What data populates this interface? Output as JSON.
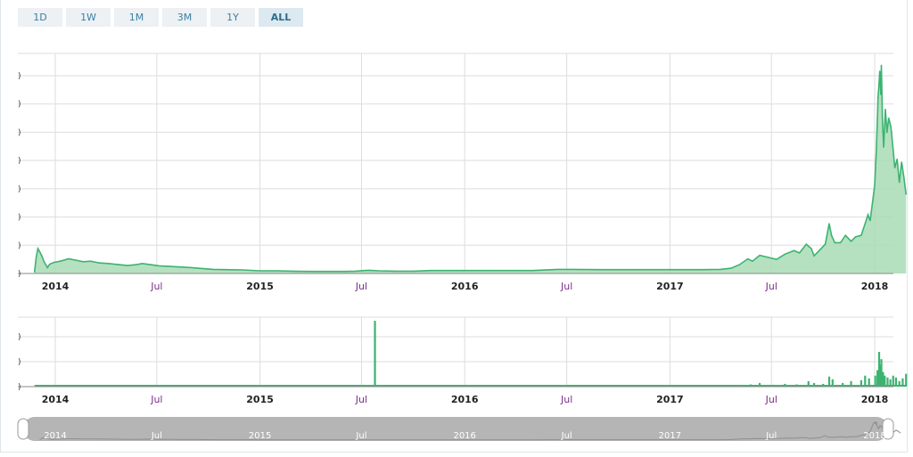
{
  "range_buttons": [
    {
      "label": "1D",
      "active": false
    },
    {
      "label": "1W",
      "active": false
    },
    {
      "label": "1M",
      "active": false
    },
    {
      "label": "3M",
      "active": false
    },
    {
      "label": "1Y",
      "active": false
    },
    {
      "label": "ALL",
      "active": true
    }
  ],
  "colors": {
    "line": "#3cb371",
    "fill": "#a8dcb5",
    "grid": "#dddddd",
    "navigator": "#b5b5b5"
  },
  "chart_data": [
    {
      "type": "area",
      "xaxis_ticks": [
        {
          "date": "2014-01-01",
          "label": "2014",
          "year": true
        },
        {
          "date": "2014-07-01",
          "label": "Jul",
          "year": false
        },
        {
          "date": "2015-01-01",
          "label": "2015",
          "year": true
        },
        {
          "date": "2015-07-01",
          "label": "Jul",
          "year": false
        },
        {
          "date": "2016-01-01",
          "label": "2016",
          "year": true
        },
        {
          "date": "2016-07-01",
          "label": "Jul",
          "year": false
        },
        {
          "date": "2017-01-01",
          "label": "2017",
          "year": true
        },
        {
          "date": "2017-07-01",
          "label": "Jul",
          "year": false
        },
        {
          "date": "2018-01-01",
          "label": "2018",
          "year": true
        }
      ],
      "ytick_labels": [
        ")",
        ")",
        ")",
        ")",
        ")",
        ")",
        ")",
        ")"
      ],
      "ylim": [
        0,
        7.5
      ],
      "grid": true,
      "points": [
        [
          "2013-11-25",
          0.05
        ],
        [
          "2013-11-28",
          0.55
        ],
        [
          "2013-12-01",
          0.85
        ],
        [
          "2013-12-04",
          0.75
        ],
        [
          "2013-12-08",
          0.6
        ],
        [
          "2013-12-12",
          0.4
        ],
        [
          "2013-12-18",
          0.2
        ],
        [
          "2013-12-22",
          0.32
        ],
        [
          "2013-12-30",
          0.38
        ],
        [
          "2014-01-10",
          0.42
        ],
        [
          "2014-01-25",
          0.5
        ],
        [
          "2014-02-05",
          0.46
        ],
        [
          "2014-02-20",
          0.4
        ],
        [
          "2014-03-05",
          0.42
        ],
        [
          "2014-03-20",
          0.36
        ],
        [
          "2014-04-10",
          0.33
        ],
        [
          "2014-04-25",
          0.3
        ],
        [
          "2014-05-10",
          0.27
        ],
        [
          "2014-05-25",
          0.3
        ],
        [
          "2014-06-05",
          0.34
        ],
        [
          "2014-06-20",
          0.3
        ],
        [
          "2014-07-05",
          0.26
        ],
        [
          "2014-07-25",
          0.24
        ],
        [
          "2014-08-15",
          0.22
        ],
        [
          "2014-09-01",
          0.2
        ],
        [
          "2014-09-20",
          0.17
        ],
        [
          "2014-10-10",
          0.14
        ],
        [
          "2014-11-01",
          0.13
        ],
        [
          "2014-12-01",
          0.12
        ],
        [
          "2015-01-01",
          0.09
        ],
        [
          "2015-02-01",
          0.09
        ],
        [
          "2015-03-01",
          0.08
        ],
        [
          "2015-04-01",
          0.07
        ],
        [
          "2015-05-01",
          0.07
        ],
        [
          "2015-06-01",
          0.07
        ],
        [
          "2015-06-20",
          0.08
        ],
        [
          "2015-07-05",
          0.1
        ],
        [
          "2015-07-15",
          0.11
        ],
        [
          "2015-08-01",
          0.09
        ],
        [
          "2015-09-01",
          0.08
        ],
        [
          "2015-10-01",
          0.08
        ],
        [
          "2015-11-01",
          0.1
        ],
        [
          "2015-12-01",
          0.1
        ],
        [
          "2016-01-01",
          0.1
        ],
        [
          "2016-03-01",
          0.1
        ],
        [
          "2016-05-01",
          0.1
        ],
        [
          "2016-06-15",
          0.14
        ],
        [
          "2016-07-10",
          0.14
        ],
        [
          "2016-09-01",
          0.13
        ],
        [
          "2016-11-01",
          0.13
        ],
        [
          "2017-01-01",
          0.13
        ],
        [
          "2017-03-01",
          0.13
        ],
        [
          "2017-04-01",
          0.14
        ],
        [
          "2017-04-20",
          0.18
        ],
        [
          "2017-05-05",
          0.3
        ],
        [
          "2017-05-20",
          0.5
        ],
        [
          "2017-05-28",
          0.42
        ],
        [
          "2017-06-10",
          0.62
        ],
        [
          "2017-06-25",
          0.55
        ],
        [
          "2017-07-10",
          0.48
        ],
        [
          "2017-07-25",
          0.66
        ],
        [
          "2017-08-10",
          0.78
        ],
        [
          "2017-08-20",
          0.7
        ],
        [
          "2017-09-01",
          1.0
        ],
        [
          "2017-09-10",
          0.85
        ],
        [
          "2017-09-15",
          0.6
        ],
        [
          "2017-09-25",
          0.8
        ],
        [
          "2017-10-05",
          1.0
        ],
        [
          "2017-10-12",
          1.7
        ],
        [
          "2017-10-16",
          1.3
        ],
        [
          "2017-10-22",
          1.05
        ],
        [
          "2017-11-01",
          1.05
        ],
        [
          "2017-11-10",
          1.3
        ],
        [
          "2017-11-20",
          1.1
        ],
        [
          "2017-11-28",
          1.25
        ],
        [
          "2017-12-08",
          1.3
        ],
        [
          "2017-12-15",
          1.7
        ],
        [
          "2017-12-20",
          2.0
        ],
        [
          "2017-12-24",
          1.8
        ],
        [
          "2017-12-28",
          2.4
        ],
        [
          "2018-01-01",
          3.0
        ],
        [
          "2018-01-04",
          4.2
        ],
        [
          "2018-01-07",
          6.0
        ],
        [
          "2018-01-09",
          6.5
        ],
        [
          "2018-01-10",
          6.9
        ],
        [
          "2018-01-12",
          6.1
        ],
        [
          "2018-01-13",
          7.1
        ],
        [
          "2018-01-15",
          5.2
        ],
        [
          "2018-01-17",
          4.3
        ],
        [
          "2018-01-20",
          5.6
        ],
        [
          "2018-01-23",
          4.8
        ],
        [
          "2018-01-26",
          5.3
        ],
        [
          "2018-01-30",
          5.0
        ],
        [
          "2018-02-03",
          4.2
        ],
        [
          "2018-02-06",
          3.6
        ],
        [
          "2018-02-10",
          3.9
        ],
        [
          "2018-02-14",
          3.1
        ],
        [
          "2018-02-18",
          3.8
        ],
        [
          "2018-02-22",
          3.3
        ],
        [
          "2018-02-26",
          2.7
        ]
      ]
    },
    {
      "type": "bar",
      "ytick_labels": [
        ")",
        ")",
        ")"
      ],
      "ylim": [
        0,
        3.8
      ],
      "grid": true,
      "spikes": [
        [
          "2015-07-25",
          3.6
        ],
        [
          "2017-04-20",
          0.05
        ],
        [
          "2017-05-10",
          0.1
        ],
        [
          "2017-05-25",
          0.12
        ],
        [
          "2017-06-10",
          0.2
        ],
        [
          "2017-07-05",
          0.1
        ],
        [
          "2017-07-25",
          0.15
        ],
        [
          "2017-08-15",
          0.12
        ],
        [
          "2017-09-05",
          0.3
        ],
        [
          "2017-09-15",
          0.2
        ],
        [
          "2017-10-01",
          0.15
        ],
        [
          "2017-10-12",
          0.55
        ],
        [
          "2017-10-18",
          0.4
        ],
        [
          "2017-11-05",
          0.2
        ],
        [
          "2017-11-20",
          0.3
        ],
        [
          "2017-12-08",
          0.35
        ],
        [
          "2017-12-15",
          0.6
        ],
        [
          "2017-12-22",
          0.45
        ],
        [
          "2018-01-02",
          0.6
        ],
        [
          "2018-01-06",
          0.9
        ],
        [
          "2018-01-09",
          1.9
        ],
        [
          "2018-01-11",
          1.2
        ],
        [
          "2018-01-13",
          1.5
        ],
        [
          "2018-01-16",
          0.8
        ],
        [
          "2018-01-19",
          0.6
        ],
        [
          "2018-01-24",
          0.5
        ],
        [
          "2018-01-29",
          0.4
        ],
        [
          "2018-02-03",
          0.6
        ],
        [
          "2018-02-08",
          0.5
        ],
        [
          "2018-02-14",
          0.3
        ],
        [
          "2018-02-20",
          0.45
        ],
        [
          "2018-02-26",
          0.7
        ]
      ]
    }
  ],
  "navigator": {
    "ticks": [
      "2014",
      "Jul",
      "2015",
      "Jul",
      "2016",
      "Jul",
      "2017",
      "Jul",
      "2018"
    ]
  }
}
